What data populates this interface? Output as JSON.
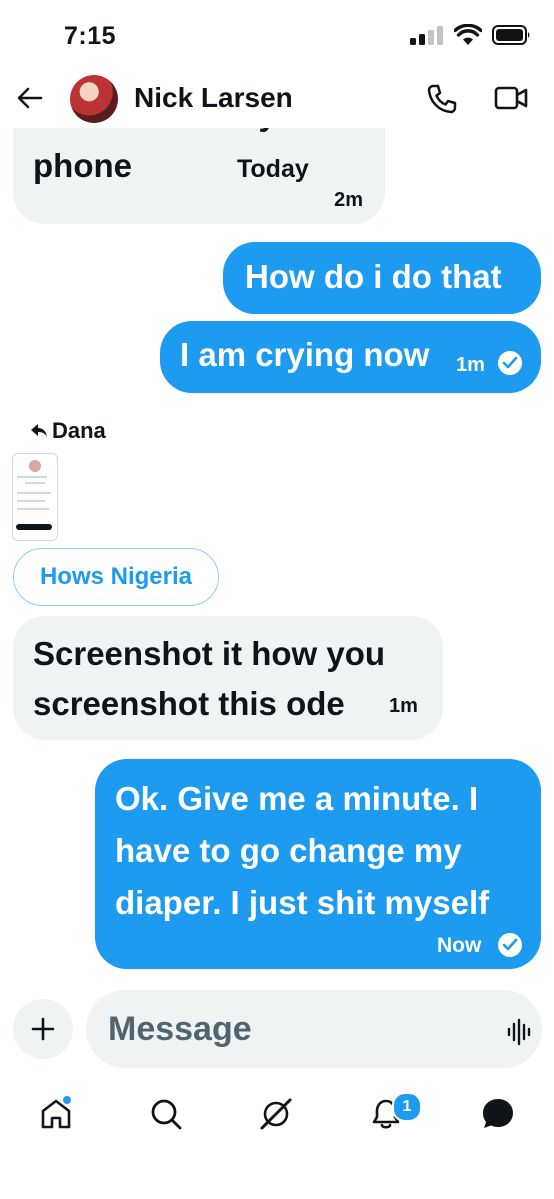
{
  "status": {
    "time": "7:15"
  },
  "header": {
    "name": "Nick Larsen"
  },
  "chat": {
    "today_label": "Today",
    "messages": [
      {
        "text": "screenshot of your phone",
        "time": "2m",
        "direction": "in"
      },
      {
        "text": "How do i do that",
        "direction": "out"
      },
      {
        "text": "I am crying now",
        "time": "1m",
        "direction": "out",
        "status": "sent"
      },
      {
        "reply_to": "Dana",
        "quoted_text": "Hows Nigeria",
        "text": "Screenshot it how you screenshot this ode",
        "time": "1m",
        "direction": "in"
      },
      {
        "text": "Ok. Give me a minute. I have to go change my diaper. I just shit myself",
        "time": "Now",
        "direction": "out",
        "status": "sent"
      }
    ]
  },
  "composer": {
    "placeholder": "Message"
  },
  "tabbar": {
    "notifications_badge": "1"
  },
  "colors": {
    "accent": "#1d9bf0",
    "bubble_in": "#eff3f4",
    "text": "#0f1419",
    "muted": "#536471"
  }
}
